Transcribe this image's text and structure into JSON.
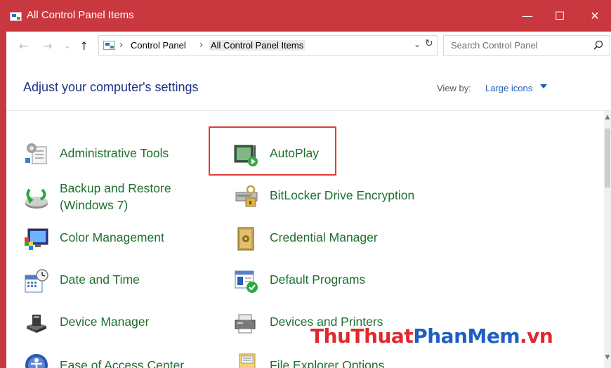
{
  "window": {
    "title": "All Control Panel Items",
    "minimize": "—",
    "maximize": "☐",
    "close": "✕"
  },
  "nav": {
    "back": "←",
    "forward": "→",
    "recent": "⌄",
    "up": "↑"
  },
  "address": {
    "sep": "›",
    "crumbs": [
      "Control Panel",
      "All Control Panel Items"
    ],
    "dropdown": "⌄",
    "refresh": "↻"
  },
  "search": {
    "placeholder": "Search Control Panel"
  },
  "header": {
    "title": "Adjust your computer's settings",
    "view_by_label": "View by:",
    "view_by_value": "Large icons"
  },
  "items": [
    {
      "label": "Administrative Tools",
      "icon": "admin-tools-icon"
    },
    {
      "label": "AutoPlay",
      "icon": "autoplay-icon"
    },
    {
      "label": "Backup and Restore",
      "label2": "(Windows 7)",
      "icon": "backup-restore-icon"
    },
    {
      "label": "BitLocker Drive Encryption",
      "icon": "bitlocker-icon"
    },
    {
      "label": "Color Management",
      "icon": "color-management-icon"
    },
    {
      "label": "Credential Manager",
      "icon": "credential-manager-icon"
    },
    {
      "label": "Date and Time",
      "icon": "date-time-icon"
    },
    {
      "label": "Default Programs",
      "icon": "default-programs-icon"
    },
    {
      "label": "Device Manager",
      "icon": "device-manager-icon"
    },
    {
      "label": "Devices and Printers",
      "icon": "devices-printers-icon"
    },
    {
      "label": "Ease of Access Center",
      "icon": "ease-of-access-icon"
    },
    {
      "label": "File Explorer Options",
      "icon": "file-explorer-options-icon"
    }
  ],
  "scroll": {
    "up": "▲",
    "down": "▼"
  },
  "watermark": {
    "part1": "ThuThuat",
    "part2": "PhanMem",
    "part3": ".vn"
  },
  "colors": {
    "titlebar": "#c9383f",
    "link_green": "#1f6f2f",
    "heading_blue": "#1e3287",
    "highlight_red": "#e43a3a"
  }
}
